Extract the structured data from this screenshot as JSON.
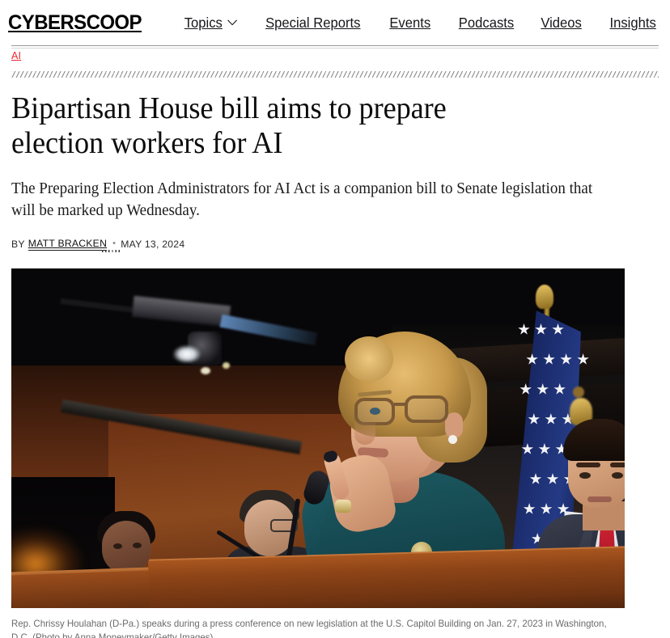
{
  "site": {
    "logo_text": "CYBERSCOOP"
  },
  "nav": {
    "items": [
      {
        "label": "Topics",
        "has_dropdown": true,
        "icon": "chevron-down-icon"
      },
      {
        "label": "Special Reports",
        "has_dropdown": false
      },
      {
        "label": "Events",
        "has_dropdown": false
      },
      {
        "label": "Podcasts",
        "has_dropdown": false
      },
      {
        "label": "Videos",
        "has_dropdown": false
      },
      {
        "label": "Insights",
        "has_dropdown": false
      }
    ]
  },
  "article": {
    "category": "AI",
    "category_color": "#e8262f",
    "headline": "Bipartisan House bill aims to prepare election workers for AI",
    "deck": "The Preparing Election Administrators for AI Act is a companion bill to Senate legislation that will be marked up Wednesday.",
    "byline": {
      "by_label": "BY",
      "author": "MATT BRACKEN",
      "separator": "•",
      "date": "MAY 13, 2024"
    },
    "hero_image": {
      "alt": "Rep. Chrissy Houlahan speaking at a podium during a press conference with an American flag behind her",
      "caption": "Rep. Chrissy Houlahan (D-Pa.) speaks during a press conference on new legislation at the U.S. Capitol Building on Jan. 27, 2023 in Washington, D.C. (Photo by Anna Moneymaker/Getty Images)"
    }
  }
}
